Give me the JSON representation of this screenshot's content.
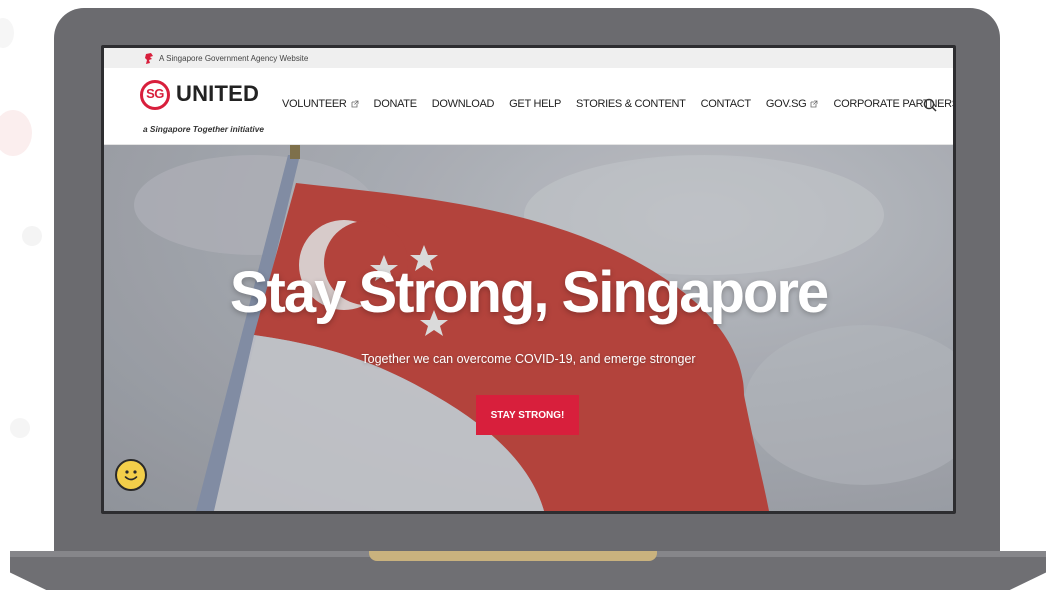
{
  "gov_bar": {
    "text": "A Singapore Government Agency Website",
    "icon": "lion-head-icon"
  },
  "logo": {
    "sg": "SG",
    "united": "UNITED",
    "tagline": "a Singapore Together initiative"
  },
  "nav": [
    {
      "label": "VOLUNTEER",
      "external": true
    },
    {
      "label": "DONATE",
      "external": false
    },
    {
      "label": "DOWNLOAD",
      "external": false
    },
    {
      "label": "GET HELP",
      "external": false
    },
    {
      "label": "STORIES & CONTENT",
      "external": false
    },
    {
      "label": "CONTACT",
      "external": false
    },
    {
      "label": "GOV.SG",
      "external": true
    },
    {
      "label": "CORPORATE PARTNERS",
      "external": false
    }
  ],
  "hero": {
    "title": "Stay Strong, Singapore",
    "subtitle": "Together we can overcome COVID-19, and emerge stronger",
    "cta": "STAY STRONG!"
  },
  "colors": {
    "brand_red": "#d81f3c",
    "laptop_gray": "#6b6b6f",
    "notch": "#c9b27e"
  }
}
